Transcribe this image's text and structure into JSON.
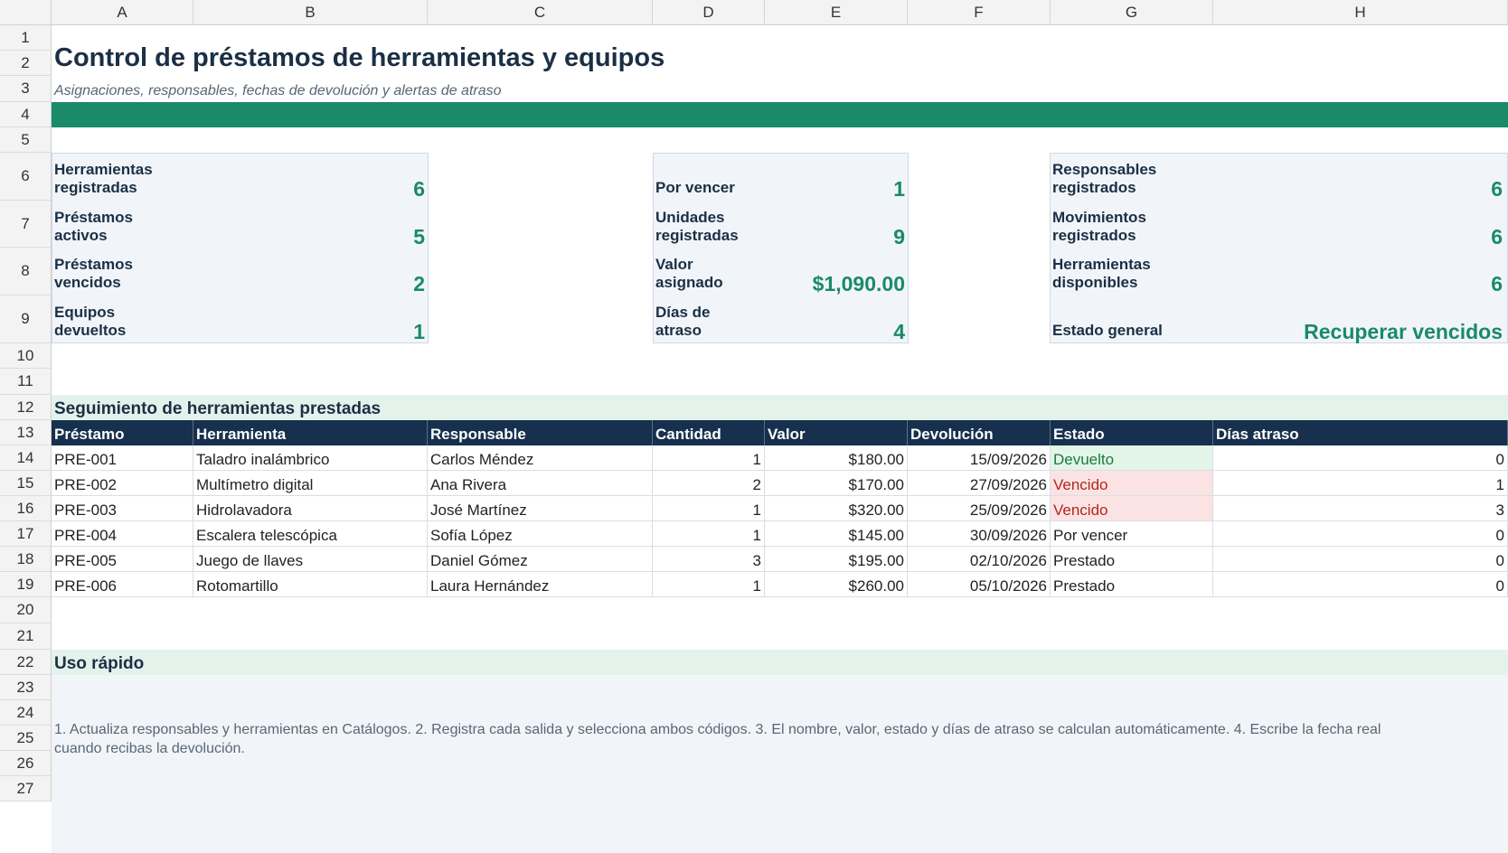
{
  "columns": [
    "A",
    "B",
    "C",
    "D",
    "E",
    "F",
    "G",
    "H"
  ],
  "rows": [
    "1",
    "2",
    "3",
    "4",
    "5",
    "6",
    "7",
    "8",
    "9",
    "10",
    "11",
    "12",
    "13",
    "14",
    "15",
    "16",
    "17",
    "18",
    "19",
    "20",
    "21",
    "22",
    "23",
    "24",
    "25",
    "26",
    "27"
  ],
  "title": "Control de préstamos de herramientas y equipos",
  "subtitle": "Asignaciones, responsables, fechas de devolución y alertas de atraso",
  "kpis": {
    "left": [
      {
        "label": "Herramientas registradas",
        "value": "6"
      },
      {
        "label": "Préstamos activos",
        "value": "5"
      },
      {
        "label": "Préstamos vencidos",
        "value": "2"
      },
      {
        "label": "Equipos devueltos",
        "value": "1"
      }
    ],
    "middle": [
      {
        "label": "Por vencer",
        "value": "1"
      },
      {
        "label": "Unidades registradas",
        "value": "9"
      },
      {
        "label": "Valor asignado",
        "value": "$1,090.00"
      },
      {
        "label": "Días de atraso",
        "value": "4"
      }
    ],
    "right": [
      {
        "label": "Responsables registrados",
        "value": "6"
      },
      {
        "label": "Movimientos registrados",
        "value": "6"
      },
      {
        "label": "Herramientas disponibles",
        "value": "6"
      },
      {
        "label": "Estado general",
        "value": "Recuperar vencidos"
      }
    ]
  },
  "tracking": {
    "section_title": "Seguimiento de herramientas prestadas",
    "headers": [
      "Préstamo",
      "Herramienta",
      "Responsable",
      "Cantidad",
      "Valor",
      "Devolución",
      "Estado",
      "Días atraso"
    ],
    "rows": [
      [
        "PRE-001",
        "Taladro inalámbrico",
        "Carlos Méndez",
        "1",
        "$180.00",
        "15/09/2026",
        "Devuelto",
        "0"
      ],
      [
        "PRE-002",
        "Multímetro digital",
        "Ana Rivera",
        "2",
        "$170.00",
        "27/09/2026",
        "Vencido",
        "1"
      ],
      [
        "PRE-003",
        "Hidrolavadora",
        "José Martínez",
        "1",
        "$320.00",
        "25/09/2026",
        "Vencido",
        "3"
      ],
      [
        "PRE-004",
        "Escalera telescópica",
        "Sofía López",
        "1",
        "$145.00",
        "30/09/2026",
        "Por vencer",
        "0"
      ],
      [
        "PRE-005",
        "Juego de llaves",
        "Daniel Gómez",
        "3",
        "$195.00",
        "02/10/2026",
        "Prestado",
        "0"
      ],
      [
        "PRE-006",
        "Rotomartillo",
        "Laura Hernández",
        "1",
        "$260.00",
        "05/10/2026",
        "Prestado",
        "0"
      ]
    ]
  },
  "quick_use": {
    "section_title": "Uso rápido",
    "text": "1. Actualiza responsables y herramientas en Catálogos.  2. Registra cada salida y selecciona ambos códigos.  3. El nombre, valor, estado y días de atraso se calculan automáticamente.  4. Escribe la fecha real cuando recibas la devolución."
  },
  "colors": {
    "accent": "#1a8a68",
    "header_dark": "#17304d",
    "section_bg": "#e3f3ec",
    "overdue": "#b3261e",
    "returned": "#1d7a3c"
  }
}
